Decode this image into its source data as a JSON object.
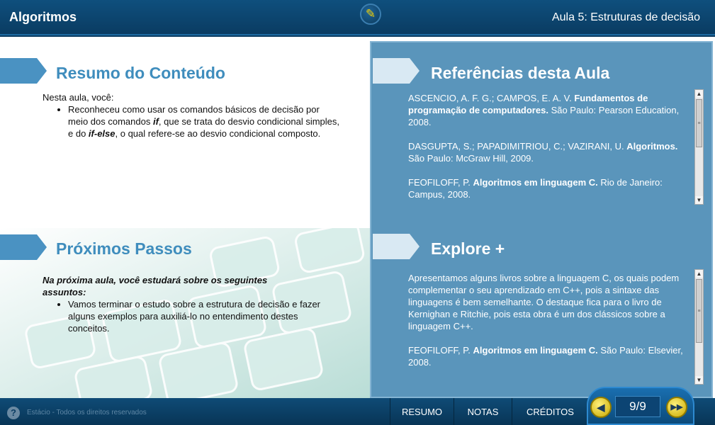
{
  "header": {
    "app_title": "Algoritmos",
    "lesson_title": "Aula 5: Estruturas de decisão"
  },
  "summary": {
    "title": "Resumo do Conteúdo",
    "intro": "Nesta aula, você:",
    "bullet_pre": "Reconheceu como usar os comandos básicos de decisão por meio dos comandos ",
    "kw_if": "if",
    "bullet_mid": ", que se trata do desvio condicional simples, e do ",
    "kw_ifelse": "if-else",
    "bullet_post": ", o qual refere-se ao desvio condicional composto."
  },
  "next_steps": {
    "title": "Próximos Passos",
    "intro": "Na próxima aula, você estudará sobre os seguintes assuntos:",
    "bullet": "Vamos terminar o estudo sobre a estrutura de decisão e fazer alguns exemplos para auxiliá-lo no entendimento destes conceitos."
  },
  "references": {
    "title": "Referências desta Aula",
    "items": [
      {
        "pre": "ASCENCIO, A. F. G.; CAMPOS, E. A. V. ",
        "bold": "Fundamentos de programação de computadores.",
        "post": " São Paulo: Pearson Education, 2008."
      },
      {
        "pre": "DASGUPTA, S.; PAPADIMITRIOU, C.; VAZIRANI, U. ",
        "bold": "Algoritmos.",
        "post": " São Paulo: McGraw Hill, 2009."
      },
      {
        "pre": "FEOFILOFF, P. ",
        "bold": "Algoritmos em linguagem C.",
        "post": " Rio de Janeiro: Campus, 2008."
      }
    ]
  },
  "explore": {
    "title": "Explore +",
    "paragraph": "Apresentamos alguns livros sobre a linguagem C, os quais podem complementar o seu aprendizado em C++, pois a sintaxe das linguagens é bem semelhante. O destaque fica para o livro de Kernighan e Ritchie, pois esta obra é um dos clássicos sobre a linguagem C++.",
    "ref": {
      "pre": "FEOFILOFF, P. ",
      "bold": "Algoritmos em linguagem C.",
      "post": " São Paulo: Elsevier, 2008."
    }
  },
  "footer": {
    "copyright": "Estácio - Todos os direitos reservados",
    "help_symbol": "?",
    "menu": [
      "RESUMO",
      "NOTAS",
      "CRÉDITOS"
    ],
    "page": "9/9",
    "prev_symbol": "◀",
    "next_symbol": "▶▶"
  },
  "colors": {
    "accent_blue": "#3f8dbd",
    "panel_blue": "#5a95bb",
    "header_dark": "#0a3c62",
    "pager_yellow": "#f5d000"
  },
  "icons": [
    "help-icon",
    "pencil-icon",
    "prev-icon",
    "next-icon",
    "scroll-up-icon",
    "scroll-down-icon"
  ]
}
